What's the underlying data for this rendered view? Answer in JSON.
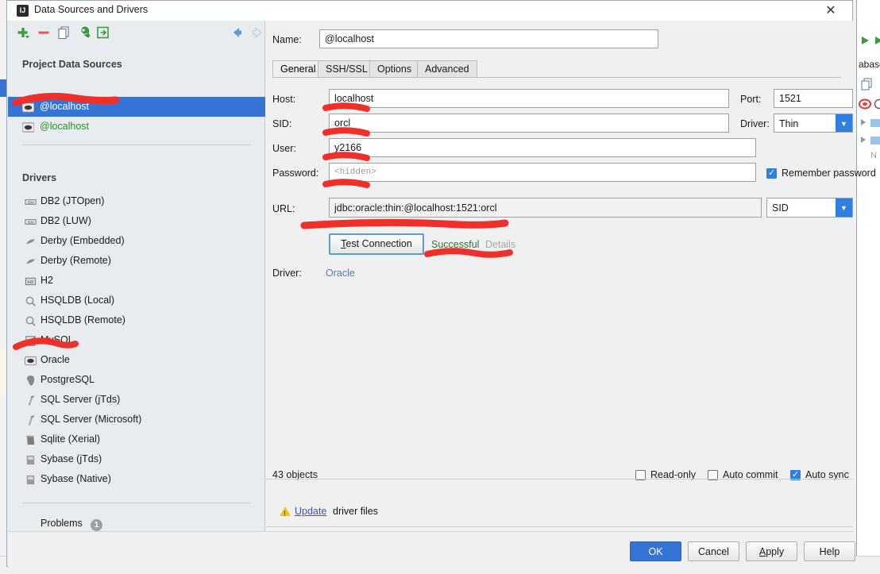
{
  "window": {
    "title": "Data Sources and Drivers",
    "icon": "intellij-idea-icon",
    "close_label": "✕"
  },
  "left_panel": {
    "toolbar": [
      {
        "name": "add-button",
        "glyph": "+"
      },
      {
        "name": "remove-button",
        "glyph": "−"
      },
      {
        "name": "copy-button",
        "glyph": "copy-icon"
      },
      {
        "name": "properties-button",
        "glyph": "wrench-icon"
      },
      {
        "name": "import-button",
        "glyph": "import-icon"
      },
      {
        "name": "back-button",
        "glyph": "arrow-left-icon"
      },
      {
        "name": "forward-button",
        "glyph": "arrow-right-icon"
      }
    ],
    "project_sources_title": "Project Data Sources",
    "data_sources": [
      {
        "label": "@localhost",
        "selected": true,
        "icon": "oracle-db-icon"
      },
      {
        "label": "@localhost",
        "selected": false,
        "icon": "oracle-db-icon",
        "obscured": true
      }
    ],
    "drivers_title": "Drivers",
    "drivers": [
      {
        "label": "DB2 (JTOpen)",
        "icon": "ibm-icon"
      },
      {
        "label": "DB2 (LUW)",
        "icon": "ibm-icon"
      },
      {
        "label": "Derby (Embedded)",
        "icon": "derby-icon"
      },
      {
        "label": "Derby (Remote)",
        "icon": "derby-icon"
      },
      {
        "label": "H2",
        "icon": "h2-icon"
      },
      {
        "label": "HSQLDB (Local)",
        "icon": "hsqldb-icon"
      },
      {
        "label": "HSQLDB (Remote)",
        "icon": "hsqldb-icon"
      },
      {
        "label": "MySQL",
        "icon": "mysql-icon"
      },
      {
        "label": "Oracle",
        "icon": "oracle-icon"
      },
      {
        "label": "PostgreSQL",
        "icon": "postgresql-icon"
      },
      {
        "label": "SQL Server (jTds)",
        "icon": "sqlserver-icon"
      },
      {
        "label": "SQL Server (Microsoft)",
        "icon": "sqlserver-icon"
      },
      {
        "label": "Sqlite (Xerial)",
        "icon": "sqlite-icon"
      },
      {
        "label": "Sybase (jTds)",
        "icon": "sybase-icon"
      },
      {
        "label": "Sybase (Native)",
        "icon": "sybase-icon"
      }
    ],
    "problems_label": "Problems",
    "problems_count": "1"
  },
  "form": {
    "name_label": "Name:",
    "name_value": "@localhost",
    "tabs": [
      {
        "label": "General",
        "active": true
      },
      {
        "label": "SSH/SSL",
        "active": false
      },
      {
        "label": "Options",
        "active": false
      },
      {
        "label": "Advanced",
        "active": false
      }
    ],
    "host_label": "Host:",
    "host_value": "localhost",
    "port_label": "Port:",
    "port_value": "1521",
    "sid_label": "SID:",
    "sid_value": "orcl",
    "driver_select_label": "Driver:",
    "driver_select_value": "Thin",
    "user_label": "User:",
    "user_value": "y2166",
    "password_label": "Password:",
    "password_value": "<hidden>",
    "remember_password_label": "Remember password",
    "remember_password_checked": true,
    "url_label": "URL:",
    "url_value": "jdbc:oracle:thin:@localhost:1521:orcl",
    "url_mode_value": "SID",
    "test_connection_label": "Test Connection",
    "test_status": "Successful",
    "test_details_label": "Details",
    "driver_label": "Driver:",
    "driver_value": "Oracle",
    "objects_count": "43 objects",
    "read_only_label": "Read-only",
    "read_only_checked": false,
    "auto_commit_label": "Auto commit",
    "auto_commit_checked": false,
    "auto_sync_label": "Auto sync",
    "auto_sync_checked": true,
    "update_link": "Update",
    "update_suffix": "driver files"
  },
  "buttons": {
    "ok": "OK",
    "cancel": "Cancel",
    "apply": "Apply",
    "help": "Help"
  },
  "background": {
    "database_label": "abase",
    "items": [
      "N"
    ]
  },
  "colors": {
    "accent_blue": "#3574d4",
    "selection_blue": "#3574d4",
    "combo_blue": "#2f7fe0",
    "success_green": "#2c7a2c",
    "marker_red": "#ee2f2a",
    "link_blue": "#4a7fb5",
    "warning_yellow": "#f0c419"
  }
}
